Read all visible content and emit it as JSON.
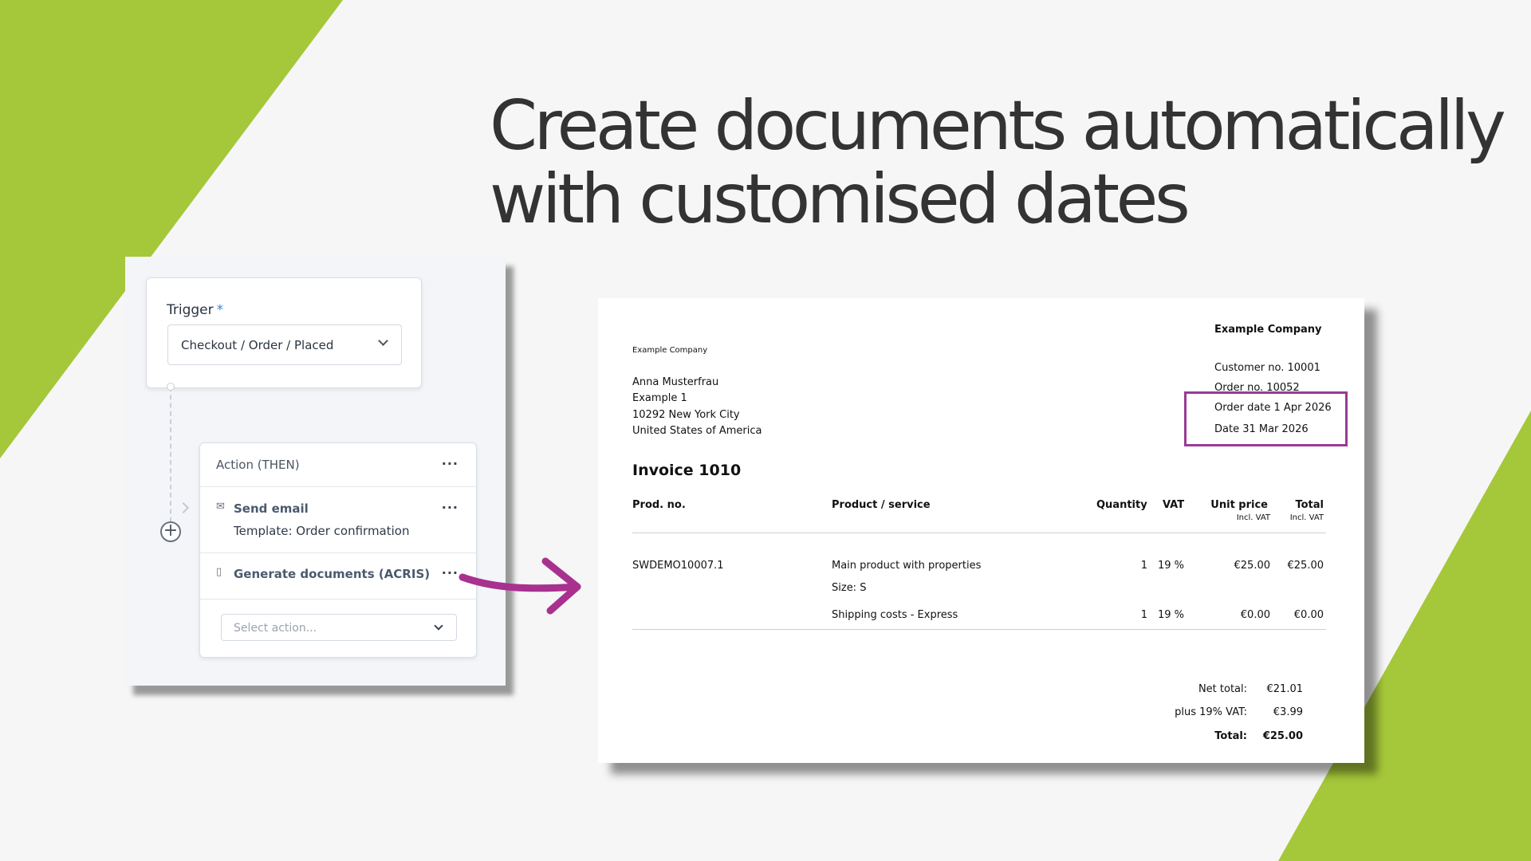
{
  "headline": {
    "line1": "Create documents automatically",
    "line2": "with customised dates"
  },
  "colors": {
    "accent_green": "#a5c73a",
    "arrow_magenta": "#a8318f",
    "highlight_border": "#9b3a95"
  },
  "workflow": {
    "trigger_label": "Trigger",
    "required_mark": "*",
    "trigger_value": "Checkout / Order / Placed",
    "action_header": "Action (THEN)",
    "menu_dots": "···",
    "add_icon": "+",
    "actions": [
      {
        "icon": "envelope-icon",
        "glyph": "✉",
        "label": "Send email",
        "sub": "Template: Order confirmation"
      },
      {
        "icon": "document-icon",
        "glyph": "▯",
        "label": "Generate documents (ACRIS)"
      }
    ],
    "select_placeholder": "Select action..."
  },
  "invoice": {
    "sender_small": "Example Company",
    "company": "Example Company",
    "recipient": [
      "Anna Musterfrau",
      "Example 1",
      "10292 New York City",
      "United States of America"
    ],
    "customer_no": "Customer no. 10001",
    "order_no": "Order no. 10052",
    "order_date": "Order date 1 Apr 2026",
    "date": "Date 31 Mar 2026",
    "title": "Invoice 1010",
    "headers": {
      "prod_no": "Prod. no.",
      "product": "Product / service",
      "quantity": "Quantity",
      "vat": "VAT",
      "unit_price": "Unit price",
      "unit_price_sub": "Incl. VAT",
      "total": "Total",
      "total_sub": "Incl. VAT"
    },
    "items": [
      {
        "prod_no": "SWDEMO10007.1",
        "product": "Main product with properties",
        "detail": "Size: S",
        "quantity": "1",
        "vat": "19 %",
        "unit_price": "€25.00",
        "total": "€25.00"
      },
      {
        "prod_no": "",
        "product": "Shipping costs - Express",
        "detail": "",
        "quantity": "1",
        "vat": "19 %",
        "unit_price": "€0.00",
        "total": "€0.00"
      }
    ],
    "totals": {
      "net_label": "Net total:",
      "net_value": "€21.01",
      "vat_label": "plus 19% VAT:",
      "vat_value": "€3.99",
      "total_label": "Total:",
      "total_value": "€25.00"
    }
  }
}
